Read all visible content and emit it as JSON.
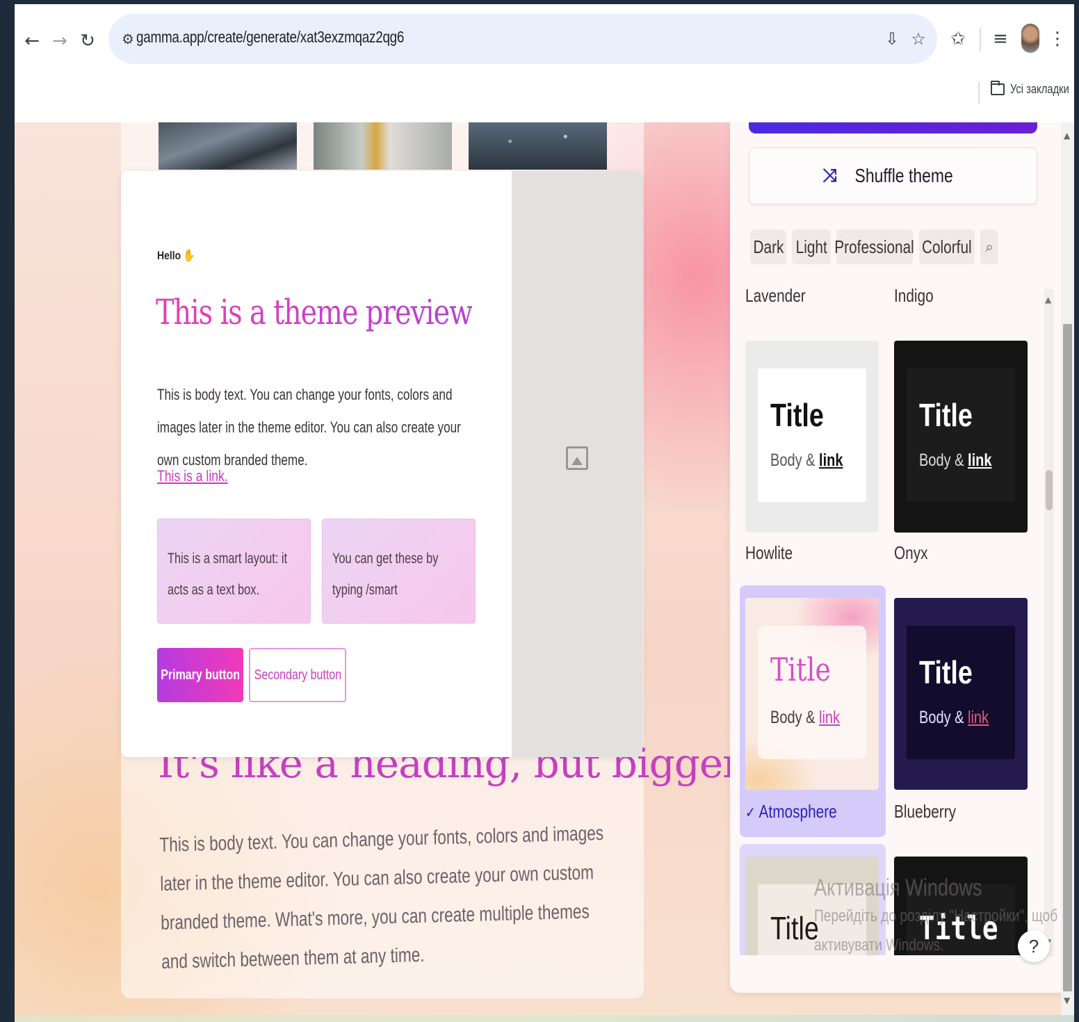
{
  "browser": {
    "url": "gamma.app/create/generate/xat3exzmqaz2qg6",
    "bookmarks_label": "Усі закладки",
    "icons": {
      "back": "arrow-left-icon",
      "forward": "arrow-right-icon",
      "reload": "reload-icon",
      "site_info": "site-settings-icon",
      "install": "install-app-icon",
      "star": "bookmark-star-icon",
      "extensions": "extensions-icon",
      "media": "media-controls-icon",
      "menu": "kebab-menu-icon"
    }
  },
  "preview": {
    "greeting": "Hello",
    "title": "This is a theme preview",
    "body": "This is body text. You can change your fonts, colors and images later in the theme editor. You can also create your own custom branded theme.",
    "link": "This is a link.",
    "smart_boxes": [
      "This is a smart layout: it acts as a text box.",
      "You can get these by typing /smart"
    ],
    "primary_button": "Primary button",
    "secondary_button": "Secondary button"
  },
  "background_doc": {
    "heading": "It's like a heading, but bigger",
    "body": "This is body text. You can change your fonts, colors and images later in the theme editor. You can also create your own custom branded theme. What's more, you can create multiple themes and switch between them at any time."
  },
  "theme_panel": {
    "shuffle_label": "Shuffle theme",
    "filters": [
      "Dark",
      "Light",
      "Professional",
      "Colorful"
    ],
    "top_labels": [
      "Lavender",
      "Indigo"
    ],
    "tile_title": "Title",
    "tile_body": "Body &",
    "tile_link": "link",
    "themes": [
      {
        "name": "Howlite",
        "selected": false
      },
      {
        "name": "Onyx",
        "selected": false
      },
      {
        "name": "Atmosphere",
        "selected": true
      },
      {
        "name": "Blueberry",
        "selected": false
      }
    ],
    "accent_color": "#2b24b8",
    "help_label": "?"
  },
  "watermark": {
    "title": "Активація Windows",
    "line1": "Перейдіть до розділу \"Настройки\", щоб",
    "line2": "активувати Windows."
  }
}
